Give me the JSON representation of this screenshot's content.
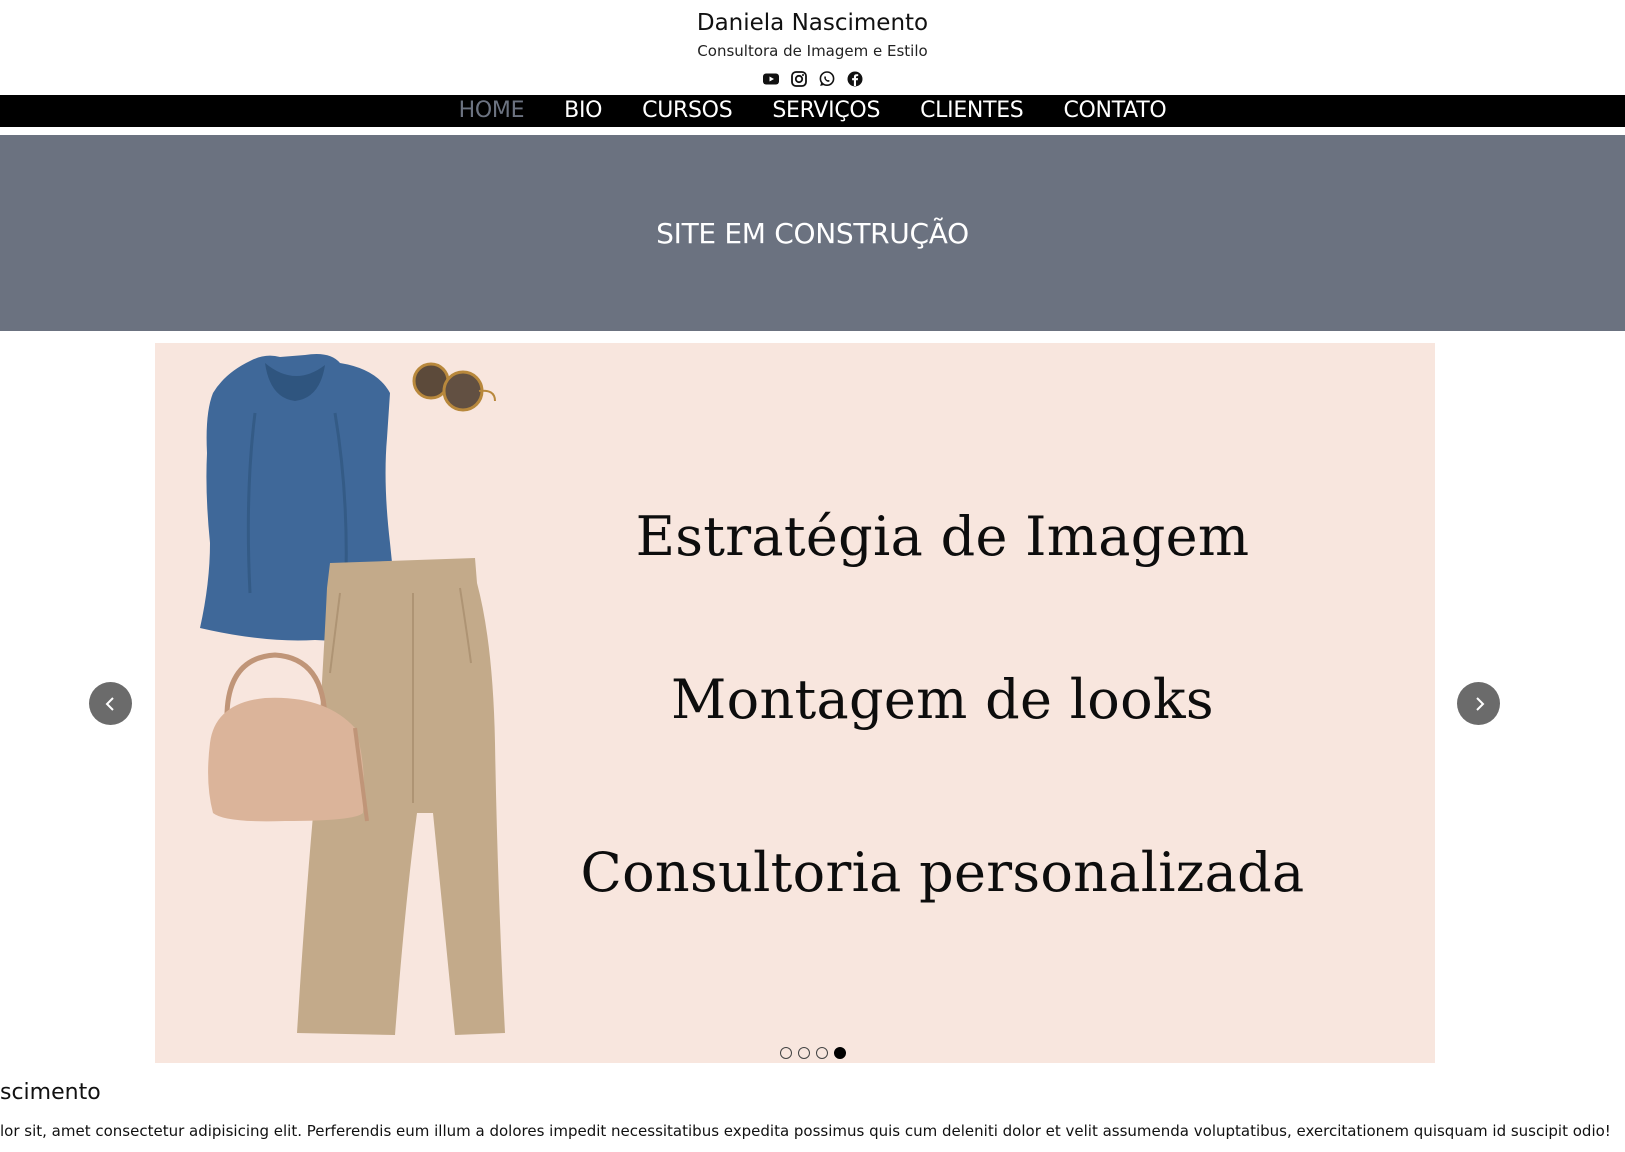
{
  "header": {
    "site_name": "Daniela Nascimento",
    "tagline": "Consultora de Imagem e Estilo",
    "social_icons": [
      "youtube-icon",
      "instagram-icon",
      "whatsapp-icon",
      "facebook-icon"
    ]
  },
  "nav": {
    "items": [
      {
        "label": "HOME",
        "active": true
      },
      {
        "label": "BIO"
      },
      {
        "label": "CURSOS"
      },
      {
        "label": "SERVIÇOS"
      },
      {
        "label": "CLIENTES"
      },
      {
        "label": "CONTATO"
      }
    ]
  },
  "banner": {
    "text": "SITE EM CONSTRUÇÃO"
  },
  "carousel": {
    "slide_lines": [
      "Estratégia de Imagem",
      "Montagem de looks",
      "Consultoria personalizada"
    ],
    "slide_count": 4,
    "active_slide": 4
  },
  "about": {
    "title": "scimento",
    "text": "lor sit, amet consectetur adipisicing elit. Perferendis eum illum a dolores impedit necessitatibus expedita possimus quis cum deleniti dolor et velit assumenda voluptatibus, exercitationem quisquam id suscipit odio!"
  },
  "colors": {
    "nav_bg": "#000000",
    "nav_active": "#6c7381",
    "banner_bg": "#6b7280",
    "slide_bg": "#f8e6de"
  }
}
